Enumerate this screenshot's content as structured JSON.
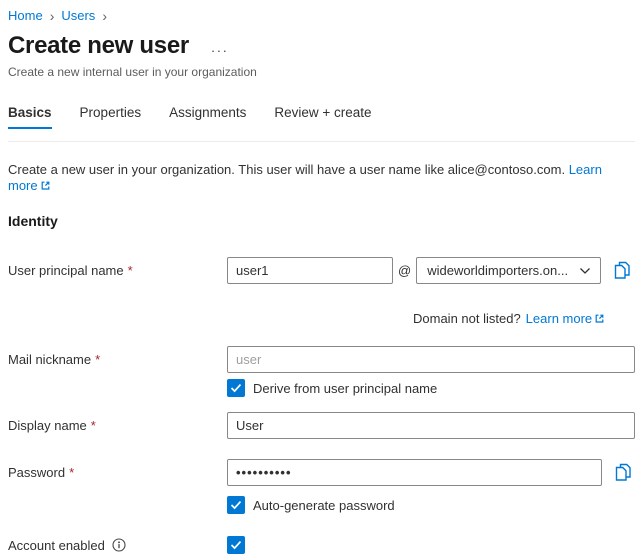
{
  "breadcrumb": {
    "separator": "›",
    "items": [
      {
        "label": "Home"
      },
      {
        "label": "Users"
      }
    ]
  },
  "header": {
    "title": "Create new user",
    "subtitle": "Create a new internal user in your organization"
  },
  "icons": {
    "more_options": "···"
  },
  "tabs": [
    {
      "label": "Basics",
      "active": true
    },
    {
      "label": "Properties",
      "active": false
    },
    {
      "label": "Assignments",
      "active": false
    },
    {
      "label": "Review + create",
      "active": false
    }
  ],
  "intro": {
    "text": "Create a new user in your organization. This user will have a user name like alice@contoso.com.",
    "learn_more_label": "Learn more"
  },
  "identity_section": {
    "title": "Identity"
  },
  "form": {
    "required_mark": "*",
    "upn": {
      "label": "User principal name",
      "value": "user1",
      "at_symbol": "@",
      "domain_selected": "wideworldimporters.on...",
      "domain_hint": "Domain not listed?",
      "learn_more_label": "Learn more"
    },
    "mail_nickname": {
      "label": "Mail nickname",
      "placeholder": "user",
      "derive_label": "Derive from user principal name",
      "derive_checked": true
    },
    "display_name": {
      "label": "Display name",
      "value": "User"
    },
    "password": {
      "label": "Password",
      "value": "••••••••••",
      "auto_label": "Auto-generate password",
      "auto_checked": true
    },
    "account_enabled": {
      "label": "Account enabled",
      "checked": true
    }
  },
  "colors": {
    "accent": "#0078d4",
    "link": "#0078d4",
    "required": "#a4262c",
    "checkbox": "#0078d4"
  }
}
